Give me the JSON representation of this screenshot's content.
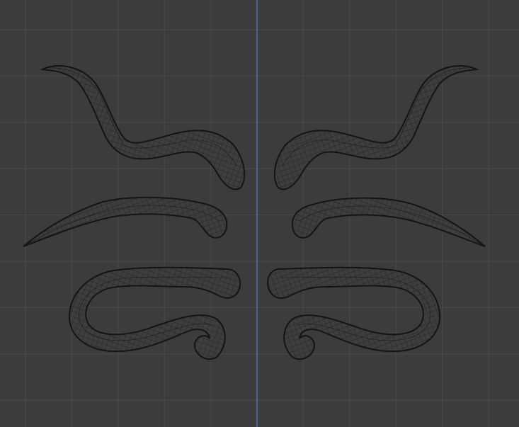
{
  "viewport": {
    "label": "",
    "background_color": "#3c3c3c",
    "grid_color": "#4a4a4a",
    "axis_color": "#5b7fc4",
    "mesh_line_color": "#141414",
    "mesh_fill_color": "#3e3e3e",
    "display_mode": "wireframe"
  },
  "objects": [
    {
      "name": "horn-top-left"
    },
    {
      "name": "horn-top-right"
    },
    {
      "name": "horn-middle-left"
    },
    {
      "name": "horn-middle-right"
    },
    {
      "name": "horn-bottom-left"
    },
    {
      "name": "horn-bottom-right"
    }
  ]
}
